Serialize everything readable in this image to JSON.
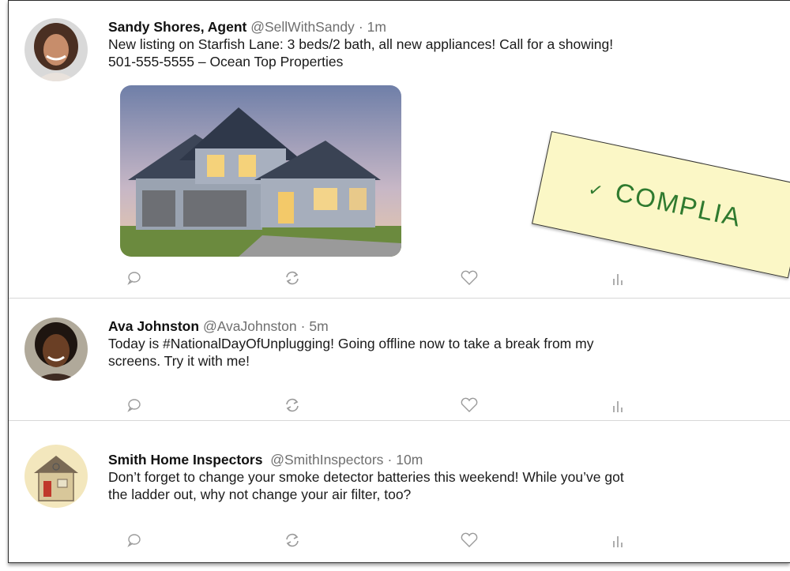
{
  "tweets": [
    {
      "name": "Sandy Shores, Agent",
      "handle": "@SellWithSandy",
      "time": "1m",
      "text_line1": "New listing on Starfish Lane: 3 beds/2 bath, all new appliances! Call for a showing!",
      "text_line2": "501-555-5555 – Ocean Top Properties"
    },
    {
      "name": "Ava Johnston",
      "handle": "@AvaJohnston",
      "time": "5m",
      "text_line1": "Today is #NationalDayOfUnplugging! Going offline now to take a break from my",
      "text_line2": "screens. Try it with me!"
    },
    {
      "name": "Smith Home Inspectors",
      "handle": "@SmithInspectors",
      "time": "10m",
      "text_line1": "Don’t forget to change your smoke detector batteries this weekend! While you’ve got",
      "text_line2": "the ladder out, why not change your air filter, too?"
    }
  ],
  "separator": "·",
  "stamp": {
    "check": "✓",
    "label": "COMPLIA"
  },
  "icons": [
    "reply-icon",
    "retweet-icon",
    "like-icon",
    "analytics-icon"
  ],
  "colors": {
    "stamp_bg": "#fbf7c6",
    "stamp_text": "#2f7a2f",
    "handle": "#6f6f6f"
  }
}
